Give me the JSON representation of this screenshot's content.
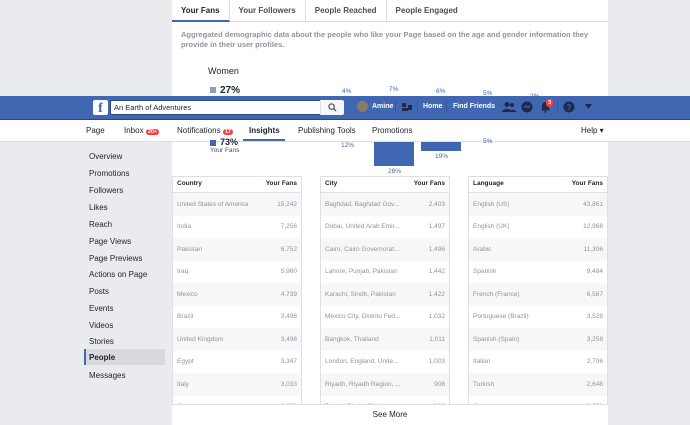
{
  "fan_tabs": [
    "Your Fans",
    "Your Followers",
    "People Reached",
    "People Engaged"
  ],
  "description": "Aggregated demographic data about the people who like your Page based on the age and gender information they provide in their user profiles.",
  "gender_chart": {
    "women_label": "Women",
    "women_percent": "27%",
    "men_percent": "73%",
    "your_fans_label": "Your Fans",
    "top_percents": [
      "4%",
      "7%",
      "6%",
      "5%",
      "2%"
    ],
    "bottom_percents": [
      "12%",
      "28%",
      "19%",
      "5%"
    ]
  },
  "header": {
    "search_value": "An Earth of Adventures",
    "user_name": "Amine",
    "home": "Home",
    "find_friends": "Find Friends",
    "notif_badge": "3"
  },
  "page_nav": {
    "page": "Page",
    "inbox": "Inbox",
    "inbox_badge": "20+",
    "notifications": "Notifications",
    "notifications_badge": "17",
    "insights": "Insights",
    "publishing_tools": "Publishing Tools",
    "promotions": "Promotions",
    "help": "Help ▾"
  },
  "sidebar": [
    "Overview",
    "Promotions",
    "Followers",
    "Likes",
    "Reach",
    "Page Views",
    "Page Previews",
    "Actions on Page",
    "Posts",
    "Events",
    "Videos",
    "Stories",
    "People",
    "Messages"
  ],
  "tables": [
    {
      "header": "Country",
      "col": "Your Fans",
      "rows": [
        [
          "United States of America",
          "15,242"
        ],
        [
          "India",
          "7,256"
        ],
        [
          "Pakistan",
          "6,752"
        ],
        [
          "Iraq",
          "5,960"
        ],
        [
          "Mexico",
          "4,739"
        ],
        [
          "Brazil",
          "3,496"
        ],
        [
          "United Kingdom",
          "3,496"
        ],
        [
          "Egypt",
          "3,347"
        ],
        [
          "Italy",
          "3,033"
        ],
        [
          "Germany",
          "2,839"
        ]
      ]
    },
    {
      "header": "City",
      "col": "Your Fans",
      "rows": [
        [
          "Baghdad, Baghdad Gov...",
          "2,403"
        ],
        [
          "Dubai, United Arab Emir...",
          "1,497"
        ],
        [
          "Cairo, Cairo Governorat...",
          "1,496"
        ],
        [
          "Lahore, Punjab, Pakistan",
          "1,442"
        ],
        [
          "Karachi, Sindh, Pakistan",
          "1,422"
        ],
        [
          "Mexico City, Distrito Fed...",
          "1,032"
        ],
        [
          "Bangkok, Thailand",
          "1,011"
        ],
        [
          "London, England, Unite...",
          "1,003"
        ],
        [
          "Riyadh, Riyadh Region, ...",
          "908"
        ],
        [
          "Dhaka, Dhaka Division, ...",
          "898"
        ]
      ]
    },
    {
      "header": "Language",
      "col": "Your Fans",
      "rows": [
        [
          "English (US)",
          "43,861"
        ],
        [
          "English (UK)",
          "12,968"
        ],
        [
          "Arabic",
          "11,306"
        ],
        [
          "Spanish",
          "9,484"
        ],
        [
          "French (France)",
          "6,587"
        ],
        [
          "Portuguese (Brazil)",
          "3,528"
        ],
        [
          "Spanish (Spain)",
          "3,258"
        ],
        [
          "Italian",
          "2,706"
        ],
        [
          "Turkish",
          "2,648"
        ],
        [
          "German",
          "2,056"
        ]
      ]
    }
  ],
  "see_more": "See More"
}
